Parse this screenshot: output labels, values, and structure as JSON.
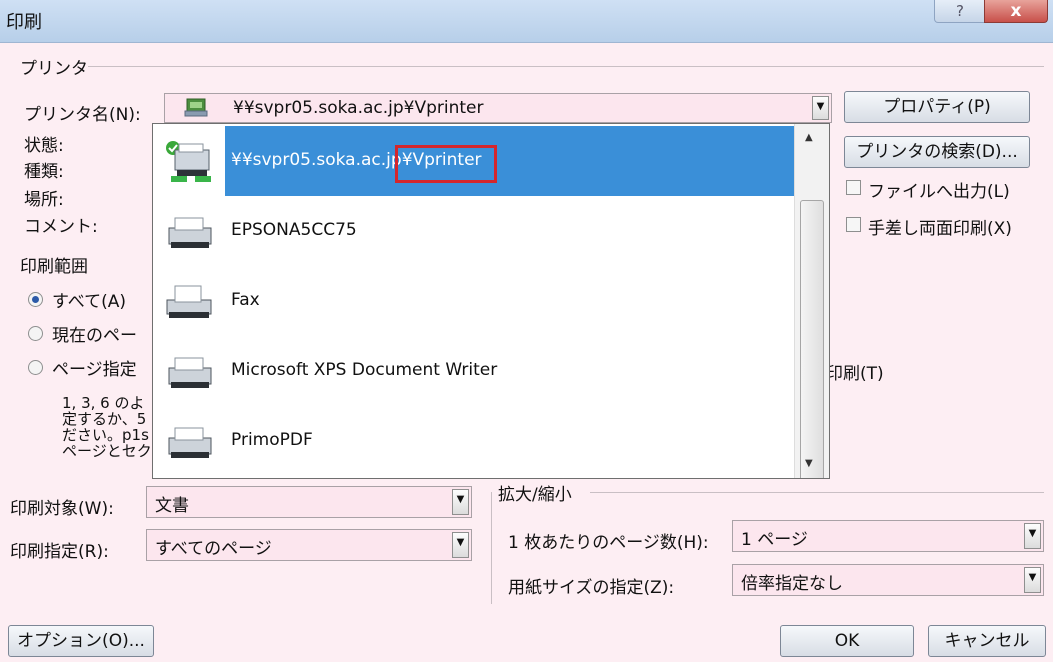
{
  "window": {
    "title": "印刷",
    "help_label": "?",
    "close_label": "x"
  },
  "printer_group": {
    "label": "プリンタ",
    "name_label": "プリンタ名(N):",
    "name_value": "¥¥svpr05.soka.ac.jp¥Vprinter",
    "status_label": "状態:",
    "type_label": "種類:",
    "location_label": "場所:",
    "comment_label": "コメント:",
    "properties_button": "プロパティ(P)",
    "find_printer_button": "プリンタの検索(D)...",
    "print_to_file": "ファイルへ出力(L)",
    "manual_duplex": "手差し両面印刷(X)"
  },
  "printer_list": {
    "items": [
      {
        "label": "¥¥svpr05.soka.ac.jp¥Vprinter",
        "selected": true,
        "icon": "network-printer-icon"
      },
      {
        "label": "EPSONA5CC75",
        "selected": false,
        "icon": "printer-icon"
      },
      {
        "label": "Fax",
        "selected": false,
        "icon": "fax-icon"
      },
      {
        "label": "Microsoft XPS Document Writer",
        "selected": false,
        "icon": "printer-icon"
      },
      {
        "label": "PrimoPDF",
        "selected": false,
        "icon": "printer-icon"
      }
    ],
    "highlight_text": "¥Vprinter",
    "selected_prefix": "¥¥svpr05.soka.ac.jp"
  },
  "range_group": {
    "label": "印刷範囲",
    "all": "すべて(A)",
    "current_page": "現在のペー",
    "pages": "ページ指定",
    "hint_line1": "1, 3, 6 のよ",
    "hint_line2": "定するか、5",
    "hint_line3": "ださい。p1s",
    "hint_line4": "ページとセク"
  },
  "collate_label": "印刷(T)",
  "print_what": {
    "label": "印刷対象(W):",
    "value": "文書"
  },
  "print_spec": {
    "label": "印刷指定(R):",
    "value": "すべてのページ"
  },
  "zoom_group": {
    "label": "拡大/縮小",
    "pages_per_sheet_label": "1 枚あたりのページ数(H):",
    "pages_per_sheet_value": "1 ページ",
    "scale_label": "用紙サイズの指定(Z):",
    "scale_value": "倍率指定なし"
  },
  "buttons": {
    "options": "オプション(O)...",
    "ok": "OK",
    "cancel": "キャンセル"
  },
  "colors": {
    "selection": "#3a8fd8",
    "highlight_border": "#d4262c",
    "dialog_bg": "#fdeef3"
  }
}
